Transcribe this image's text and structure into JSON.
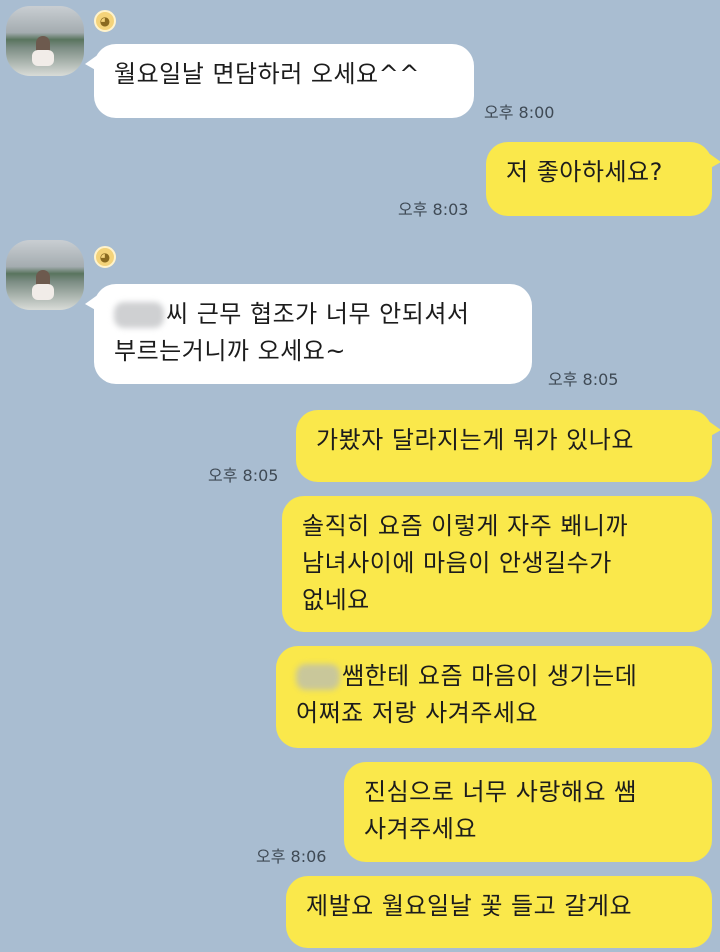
{
  "chat": {
    "messages": [
      {
        "side": "in",
        "text": "월요일날 면담하러 오세요^^",
        "time": "오후 8:00"
      },
      {
        "side": "out",
        "text": "저 좋아하세요?",
        "time": "오후 8:03"
      },
      {
        "side": "in",
        "text_suffix": "씨 근무 협조가 너무 안되셔서\n부르는거니까 오세요~",
        "time": "오후 8:05"
      },
      {
        "side": "out",
        "text": "가봤자 달라지는게 뭐가 있나요",
        "time": "오후 8:05"
      },
      {
        "side": "out",
        "text": "솔직히 요즘 이렇게 자주 봬니까\n남녀사이에 마음이 안생길수가\n없네요"
      },
      {
        "side": "out",
        "text_suffix": "쌤한테 요즘 마음이 생기는데\n어쩌죠 저랑 사겨주세요"
      },
      {
        "side": "out",
        "text": "진심으로 너무 사랑해요 쌤\n사겨주세요",
        "time": "오후 8:06"
      },
      {
        "side": "out",
        "text": "제발요 월요일날 꽃 들고 갈게요"
      }
    ]
  },
  "colors": {
    "background": "#a9bdd1",
    "incoming_bubble": "#ffffff",
    "outgoing_bubble": "#fae84b"
  },
  "icons": {
    "sender_badge": "baby-face-icon",
    "avatar": "profile-photo"
  }
}
